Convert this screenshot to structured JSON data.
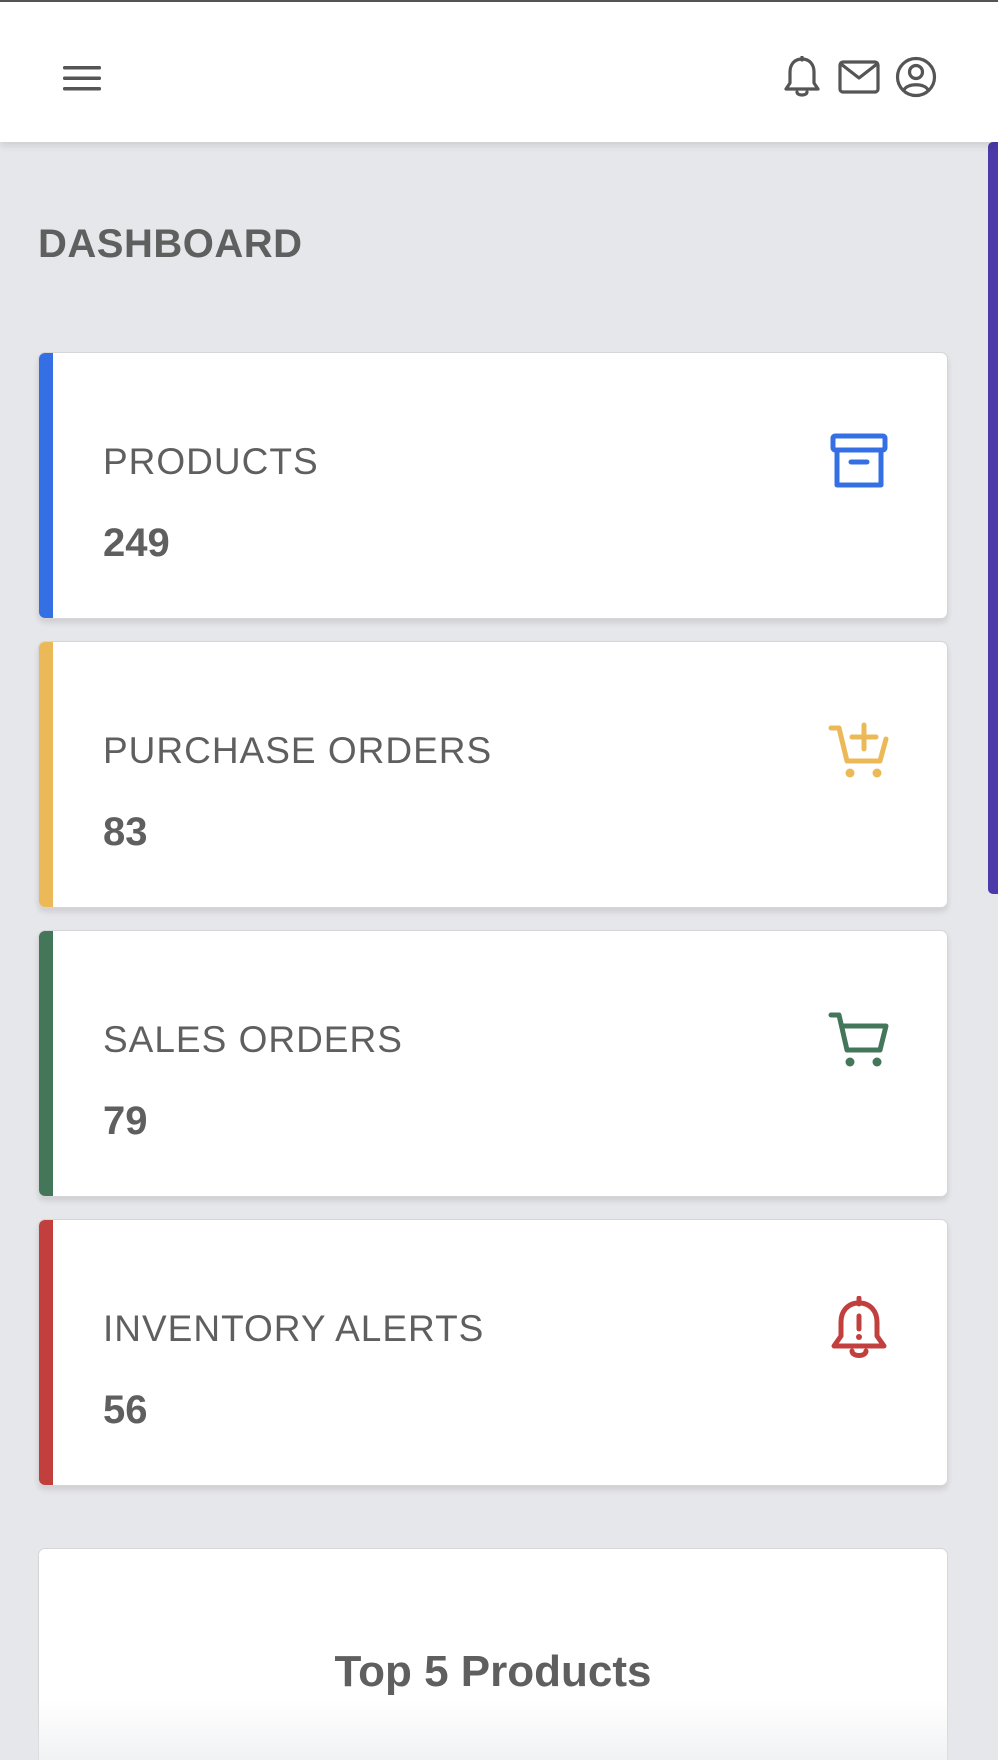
{
  "header": {
    "icons": [
      "menu-icon",
      "bell-icon",
      "mail-icon",
      "user-circle-icon"
    ]
  },
  "page": {
    "title": "DASHBOARD"
  },
  "cards": [
    {
      "label": "PRODUCTS",
      "value": "249",
      "icon": "archive-box-icon",
      "color": "#3470e4"
    },
    {
      "label": "PURCHASE ORDERS",
      "value": "83",
      "icon": "cart-plus-icon",
      "color": "#ecb959"
    },
    {
      "label": "SALES ORDERS",
      "value": "79",
      "icon": "cart-icon",
      "color": "#44775a"
    },
    {
      "label": "INVENTORY ALERTS",
      "value": "56",
      "icon": "bell-alert-icon",
      "color": "#c1403d"
    }
  ],
  "chart": {
    "title": "Top 5 Products"
  },
  "colors": {
    "background": "#e6e7ea",
    "text": "#5f5f5f",
    "scrollbar": "#4b3aa8"
  }
}
